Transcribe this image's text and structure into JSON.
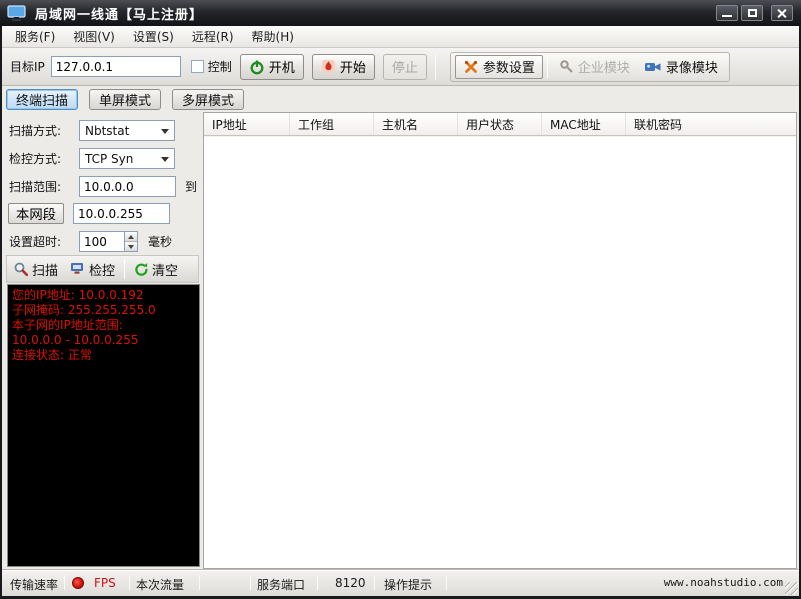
{
  "window": {
    "title": "局域网一线通【马上注册】"
  },
  "menu": {
    "items": [
      "服务(F)",
      "视图(V)",
      "设置(S)",
      "远程(R)",
      "帮助(H)"
    ]
  },
  "toolbar": {
    "target_ip_label": "目标IP",
    "target_ip_value": "127.0.0.1",
    "control_label": "控制",
    "power_label": "开机",
    "start_label": "开始",
    "stop_label": "停止",
    "params_label": "参数设置",
    "enterprise_label": "企业模块",
    "video_label": "录像模块"
  },
  "tabs": [
    "终端扫描",
    "单屏模式",
    "多屏模式"
  ],
  "panel": {
    "scan_mode_label": "扫描方式:",
    "scan_mode_value": "Nbtstat",
    "monitor_mode_label": "检控方式:",
    "monitor_mode_value": "TCP Syn",
    "scan_range_label": "扫描范围:",
    "scan_range_start": "10.0.0.0",
    "to_label": "到",
    "subnet_button_label": "本网段",
    "scan_range_end": "10.0.0.255",
    "timeout_label": "设置超时:",
    "timeout_value": "100",
    "timeout_unit": "毫秒",
    "scan_button_label": "扫描",
    "monitor_button_label": "检控",
    "clear_button_label": "清空",
    "console_lines": [
      "您的IP地址: 10.0.0.192",
      "子网掩码: 255.255.255.0",
      "本子网的IP地址范围:",
      "10.0.0.0 - 10.0.0.255",
      "连接状态: 正常"
    ]
  },
  "table": {
    "headers": [
      "IP地址",
      "工作组",
      "主机名",
      "用户状态",
      "MAC地址",
      "联机密码"
    ]
  },
  "statusbar": {
    "transfer_label": "传输速率",
    "fps_label": "FPS",
    "traffic_label": "本次流量",
    "port_label": "服务端口",
    "port_value": "8120",
    "hint_label": "操作提示",
    "website": "www.noahstudio.com"
  },
  "colors": {
    "console_bg": "#000000",
    "console_text": "#dd1100",
    "fps_text": "#cc1111",
    "active_tab_border": "#4a90c8",
    "power_icon": "#1f8c1f",
    "start_icon": "#d03020"
  }
}
